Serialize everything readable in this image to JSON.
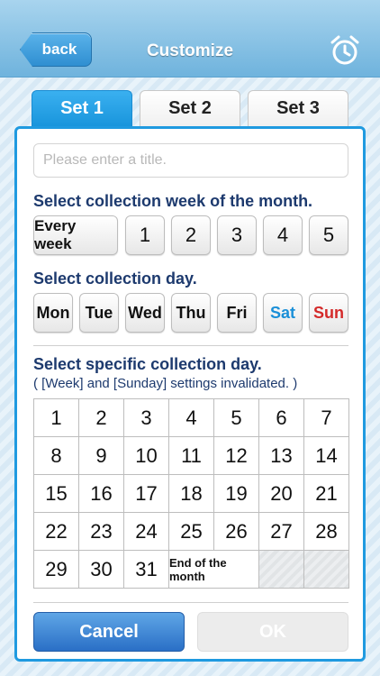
{
  "header": {
    "back_label": "back",
    "title": "Customize",
    "alarm_icon": "alarm-clock-icon"
  },
  "tabs": [
    {
      "label": "Set 1",
      "active": true
    },
    {
      "label": "Set 2",
      "active": false
    },
    {
      "label": "Set 3",
      "active": false
    }
  ],
  "title_input": {
    "value": "",
    "placeholder": "Please enter a title."
  },
  "week_section": {
    "label": "Select collection week of the month.",
    "options": [
      "Every week",
      "1",
      "2",
      "3",
      "4",
      "5"
    ]
  },
  "day_section": {
    "label": "Select collection day.",
    "options": [
      "Mon",
      "Tue",
      "Wed",
      "Thu",
      "Fri",
      "Sat",
      "Sun"
    ]
  },
  "specific_section": {
    "label": "Select specific collection day.",
    "note": "( [Week] and [Sunday] settings invalidated. )",
    "days": [
      "1",
      "2",
      "3",
      "4",
      "5",
      "6",
      "7",
      "8",
      "9",
      "10",
      "11",
      "12",
      "13",
      "14",
      "15",
      "16",
      "17",
      "18",
      "19",
      "20",
      "21",
      "22",
      "23",
      "24",
      "25",
      "26",
      "27",
      "28",
      "29",
      "30",
      "31"
    ],
    "end_of_month_label": "End of the month"
  },
  "buttons": {
    "cancel": "Cancel",
    "ok": "OK"
  },
  "colors": {
    "accent": "#1f9ae0",
    "saturday": "#1a8fd8",
    "sunday": "#d42a2a",
    "label": "#1d3a6e"
  }
}
